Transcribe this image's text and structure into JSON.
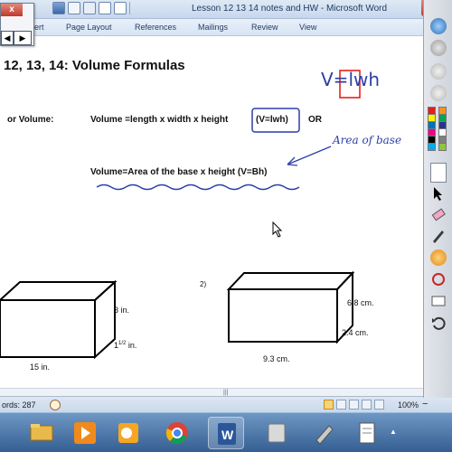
{
  "window": {
    "title": "Lesson 12 13 14 notes and HW - Microsoft Word"
  },
  "ribbon": {
    "tabs": [
      "ert",
      "Page Layout",
      "References",
      "Mailings",
      "Review",
      "View"
    ]
  },
  "floating_toolbar": {
    "close_label": "x",
    "prev_label": "◀",
    "next_label": "▶"
  },
  "document": {
    "title": "12, 13, 14:  Volume Formulas",
    "label_volume": "or Volume:",
    "formula_1": "Volume =length x width x height",
    "formula_1_symbol": "(V=lwh)",
    "formula_or": "OR",
    "formula_2": "Volume=Area of the base x height  (V=Bh)",
    "handwritten_formula": "V=lwh",
    "handwritten_note": "Area of base",
    "problem_1": {
      "height": "3 in.",
      "width_whole": "1",
      "width_num": "1",
      "width_den": "2",
      "width_unit": "in.",
      "length": "15 in."
    },
    "problem_2": {
      "number": "2)",
      "height": "6.8 cm.",
      "width": "2.4 cm.",
      "length": "9.3 cm."
    }
  },
  "status_bar": {
    "word_count": "ords: 287",
    "zoom_level": "100%",
    "zoom_minus": "−"
  },
  "pen_toolbar": {
    "colors": [
      "#e81c1c",
      "#f7941d",
      "#fff200",
      "#00a651",
      "#0072bc",
      "#2e3192",
      "#ec008c",
      "#ffffff",
      "#000000",
      "#808080",
      "#00aeef",
      "#8dc63f"
    ]
  },
  "taskbar": {
    "apps": [
      "ie-icon",
      "file-explorer-icon",
      "media-player-icon",
      "outlook-icon",
      "chrome-icon",
      "word-icon",
      "recycle-icon",
      "tool-icon",
      "notepad-icon"
    ],
    "tray_label": "▲"
  },
  "colors": {
    "handwriting": "#2d3fa8",
    "highlight_red": "#e82020"
  }
}
